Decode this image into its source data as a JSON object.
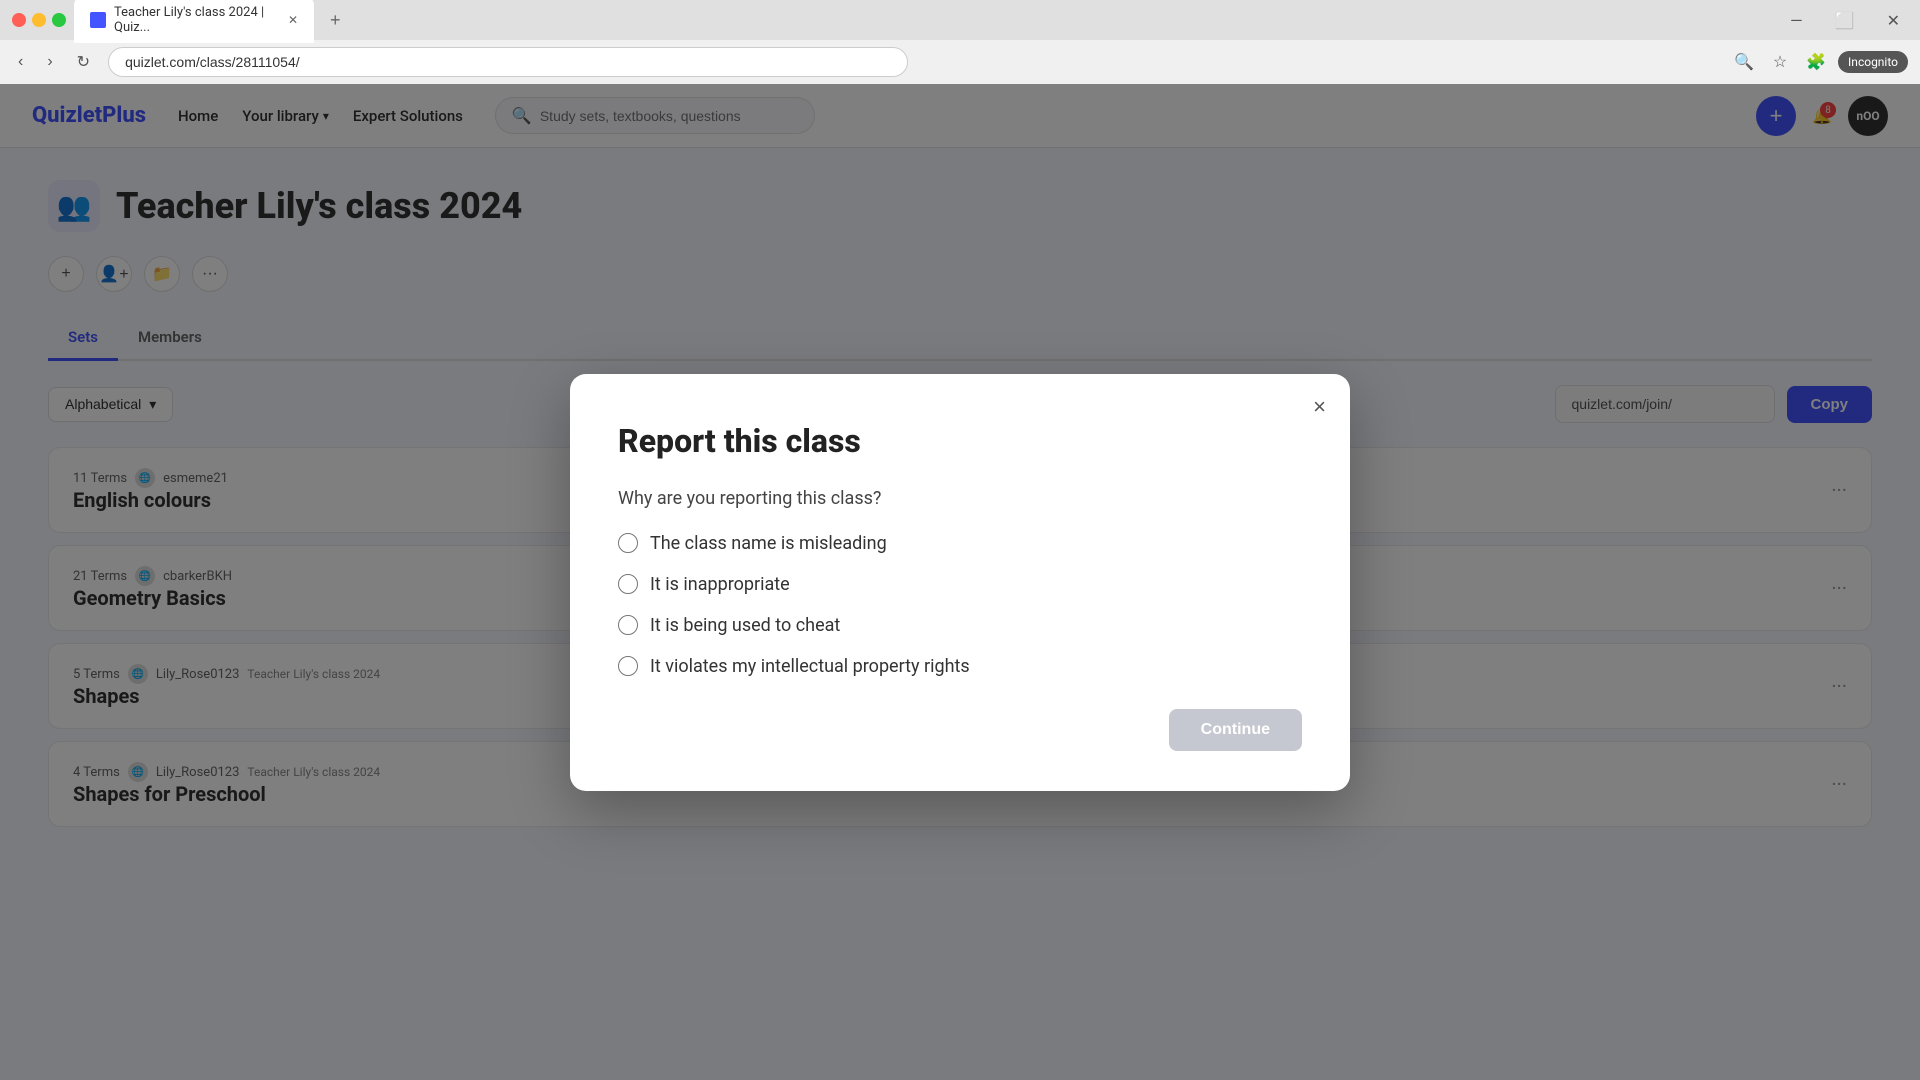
{
  "browser": {
    "tab_title": "Teacher Lily's class 2024 | Quiz...",
    "url": "quizlet.com/class/28111054/",
    "new_tab_label": "+",
    "incognito_label": "Incognito"
  },
  "header": {
    "logo": "QuizletPlus",
    "nav": {
      "home": "Home",
      "your_library": "Your library",
      "expert_solutions": "Expert Solutions"
    },
    "search_placeholder": "Study sets, textbooks, questions",
    "add_btn": "+",
    "notif_count": "8",
    "user_initials": "nOO"
  },
  "page": {
    "class_title": "Teacher Lily's class 2024",
    "tabs": [
      "Sets",
      "Members"
    ],
    "active_tab": "Sets",
    "filter": {
      "label": "Alphabetical"
    },
    "join_link": "quizlet.com/join/",
    "copy_label": "Copy"
  },
  "sets": [
    {
      "terms": "11 Terms",
      "user": "esmeme21",
      "name": "English colours",
      "tag": ""
    },
    {
      "terms": "21 Terms",
      "user": "cbarkerBKH",
      "name": "Geometry Basics",
      "tag": ""
    },
    {
      "terms": "5 Terms",
      "user": "Lily_Rose0123",
      "class_tag": "Teacher Lily's class 2024",
      "name": "Shapes",
      "tag": ""
    },
    {
      "terms": "4 Terms",
      "user": "Lily_Rose0123",
      "class_tag": "Teacher Lily's class 2024",
      "name": "Shapes for Preschool",
      "tag": ""
    }
  ],
  "modal": {
    "title": "Report this class",
    "question": "Why are you reporting this class?",
    "options": [
      {
        "id": "opt1",
        "label": "The class name is misleading"
      },
      {
        "id": "opt2",
        "label": "It is inappropriate"
      },
      {
        "id": "opt3",
        "label": "It is being used to cheat"
      },
      {
        "id": "opt4",
        "label": "It violates my intellectual property rights"
      }
    ],
    "continue_label": "Continue",
    "close_label": "×"
  },
  "icons": {
    "search": "🔍",
    "chevron_down": "▾",
    "plus": "+",
    "user_add": "👤",
    "folder": "📁",
    "more": "···",
    "bell": "🔔",
    "group": "👥"
  }
}
